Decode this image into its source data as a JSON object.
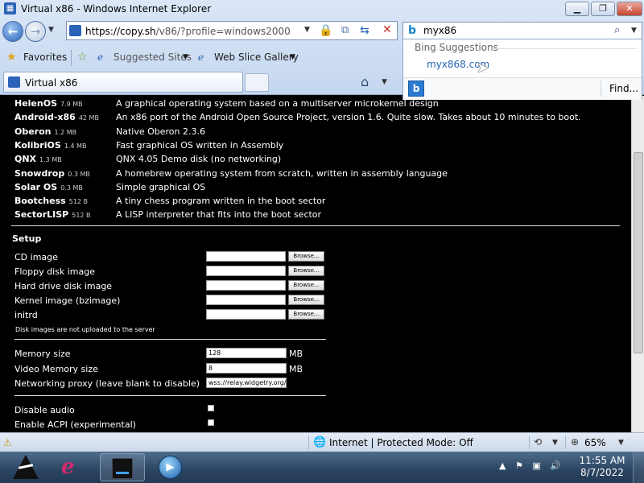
{
  "window": {
    "title": "Virtual x86 - Windows Internet Explorer",
    "minimize_icon": "minimize-icon",
    "maximize_icon": "maximize-icon",
    "close_icon": "close-icon"
  },
  "nav": {
    "url_host": "https://copy.sh",
    "url_path": "/v86/?profile=windows2000",
    "back_icon": "back-arrow-icon",
    "forward_icon": "forward-arrow-icon"
  },
  "search": {
    "value": "myx86",
    "provider": "Bing",
    "suggestions_header": "Bing Suggestions",
    "suggestions": [
      "myx868.com"
    ],
    "find_label": "Find..."
  },
  "favorites_bar": {
    "favorites_label": "Favorites",
    "suggested_sites_label": "Suggested Sites",
    "web_slice_label": "Web Slice Gallery"
  },
  "tabs": [
    {
      "label": "Virtual x86",
      "active": true
    }
  ],
  "os_list": [
    {
      "name": "HelenOS",
      "size": "7.9 MB",
      "description": "A graphical operating system based on a multiserver microkernel design"
    },
    {
      "name": "Android-x86",
      "size": "42 MB",
      "description": "An x86 port of the Android Open Source Project, version 1.6. Quite slow. Takes about 10 minutes to boot."
    },
    {
      "name": "Oberon",
      "size": "1.2 MB",
      "description": "Native Oberon 2.3.6"
    },
    {
      "name": "KolibriOS",
      "size": "1.4 MB",
      "description": "Fast graphical OS written in Assembly"
    },
    {
      "name": "QNX",
      "size": "1.3 MB",
      "description": "QNX 4.05 Demo disk (no networking)"
    },
    {
      "name": "Snowdrop",
      "size": "0.3 MB",
      "description": "A homebrew operating system from scratch, written in assembly language"
    },
    {
      "name": "Solar OS",
      "size": "0.3 MB",
      "description": "Simple graphical OS"
    },
    {
      "name": "Bootchess",
      "size": "512 B",
      "description": "A tiny chess program written in the boot sector"
    },
    {
      "name": "SectorLISP",
      "size": "512 B",
      "description": "A LISP interpreter that fits into the boot sector"
    }
  ],
  "setup": {
    "title": "Setup",
    "browse_label": "Browse...",
    "images": [
      {
        "label": "CD image"
      },
      {
        "label": "Floppy disk image"
      },
      {
        "label": "Hard drive disk image"
      },
      {
        "label": "Kernel image (bzimage)"
      },
      {
        "label": "initrd"
      }
    ],
    "note": "Disk images are not uploaded to the server",
    "memory_label": "Memory size",
    "memory_value": "128",
    "memory_unit": "MB",
    "video_memory_label": "Video Memory size",
    "video_memory_value": "8",
    "video_memory_unit": "MB",
    "proxy_label": "Networking proxy (leave blank to disable)",
    "proxy_value": "wss://relay.widgetry.org/",
    "disable_audio_label": "Disable audio",
    "acpi_label": "Enable ACPI (experimental)"
  },
  "status": {
    "zone_text": "Internet | Protected Mode: Off",
    "zoom_text": "65%"
  },
  "taskbar": {
    "time": "11:55 AM",
    "date": "8/7/2022",
    "apps": [
      "start-logo-icon",
      "internet-explorer-icon",
      "drive-icon",
      "media-player-icon"
    ]
  }
}
